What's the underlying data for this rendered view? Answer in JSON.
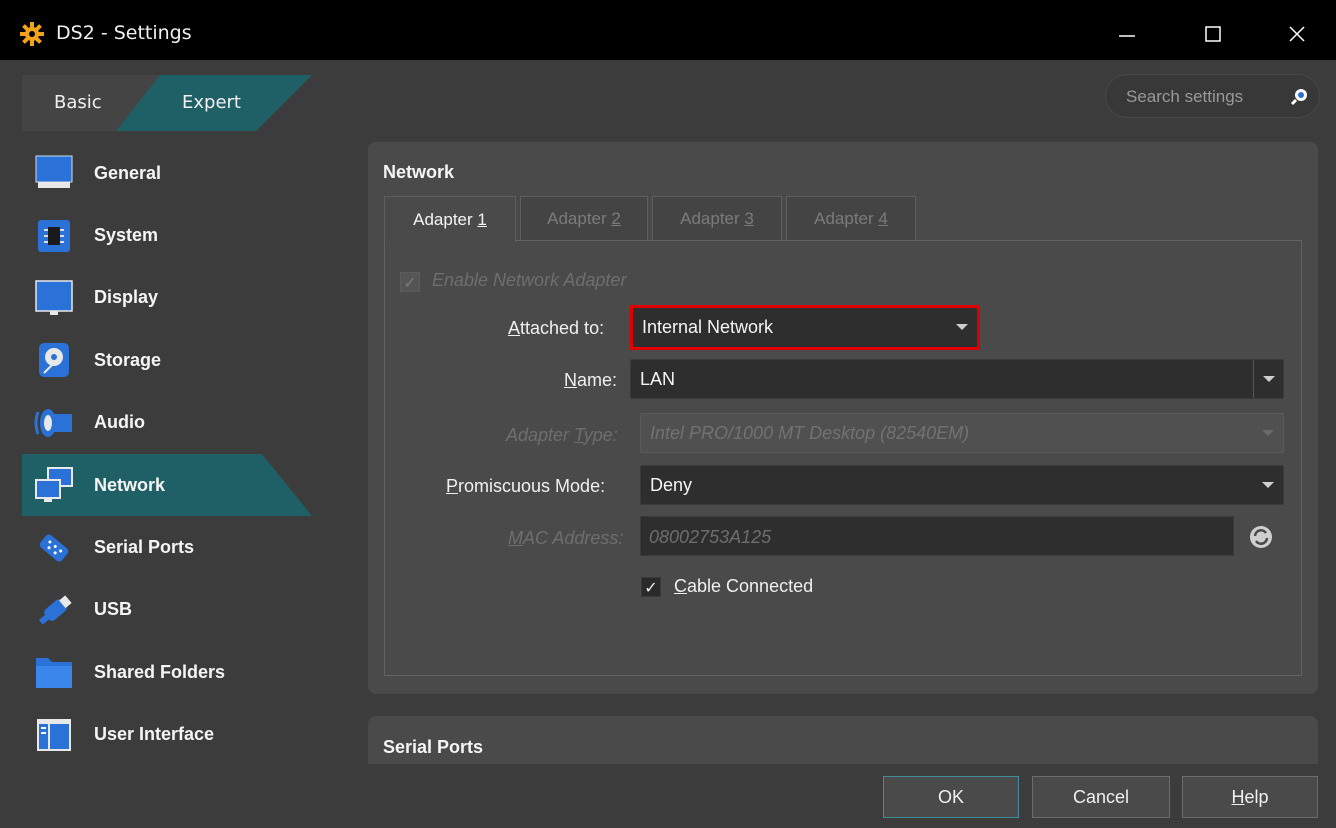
{
  "window": {
    "title": "DS2 - Settings",
    "controls": [
      "minimize",
      "maximize",
      "close"
    ]
  },
  "mode_tabs": {
    "basic_label": "Basic",
    "expert_label": "Expert",
    "selected": "Expert"
  },
  "search": {
    "placeholder": "Search settings"
  },
  "sidebar": {
    "selected": "Network",
    "items": [
      {
        "label": "General",
        "icon": "monitor-icon"
      },
      {
        "label": "System",
        "icon": "chip-icon"
      },
      {
        "label": "Display",
        "icon": "display-icon"
      },
      {
        "label": "Storage",
        "icon": "disk-icon"
      },
      {
        "label": "Audio",
        "icon": "speaker-icon"
      },
      {
        "label": "Network",
        "icon": "network-icon"
      },
      {
        "label": "Serial Ports",
        "icon": "serial-port-icon"
      },
      {
        "label": "USB",
        "icon": "usb-icon"
      },
      {
        "label": "Shared Folders",
        "icon": "folder-icon"
      },
      {
        "label": "User Interface",
        "icon": "window-layout-icon"
      }
    ]
  },
  "network": {
    "section_title": "Network",
    "tabs": [
      {
        "prefix": "Adapter ",
        "mnemonic": "1",
        "active": true
      },
      {
        "prefix": "Adapter ",
        "mnemonic": "2",
        "active": false
      },
      {
        "prefix": "Adapter ",
        "mnemonic": "3",
        "active": false
      },
      {
        "prefix": "Adapter ",
        "mnemonic": "4",
        "active": false
      }
    ],
    "enable_adapter": {
      "label": "Enable Network Adapter",
      "checked": true,
      "enabled": false
    },
    "attached_to": {
      "label_mnemonic": "A",
      "label_rest": "ttached to:",
      "value": "Internal Network"
    },
    "name": {
      "label_mnemonic": "N",
      "label_rest": "ame:",
      "value": "LAN"
    },
    "adapter_type": {
      "label_pre": "Adapter ",
      "label_mnemonic": "T",
      "label_rest": "ype:",
      "value": "Intel PRO/1000 MT Desktop (82540EM)",
      "enabled": false
    },
    "promiscuous_mode": {
      "label_mnemonic": "P",
      "label_rest": "romiscuous Mode:",
      "value": "Deny"
    },
    "mac_address": {
      "label_mnemonic": "M",
      "label_rest": "AC Address:",
      "value": "08002753A125",
      "enabled": false
    },
    "cable_connected": {
      "label_mnemonic": "C",
      "label_rest": "able Connected",
      "checked": true
    }
  },
  "serial_ports": {
    "section_title": "Serial Ports"
  },
  "footer": {
    "ok_label": "OK",
    "cancel_label": "Cancel",
    "help_mnemonic": "H",
    "help_rest": "elp"
  },
  "colors": {
    "accent_teal": "#1f5f66",
    "highlight_red": "#e00000",
    "window_bg": "#3c3c3c",
    "panel_bg": "#4a4a4a"
  }
}
